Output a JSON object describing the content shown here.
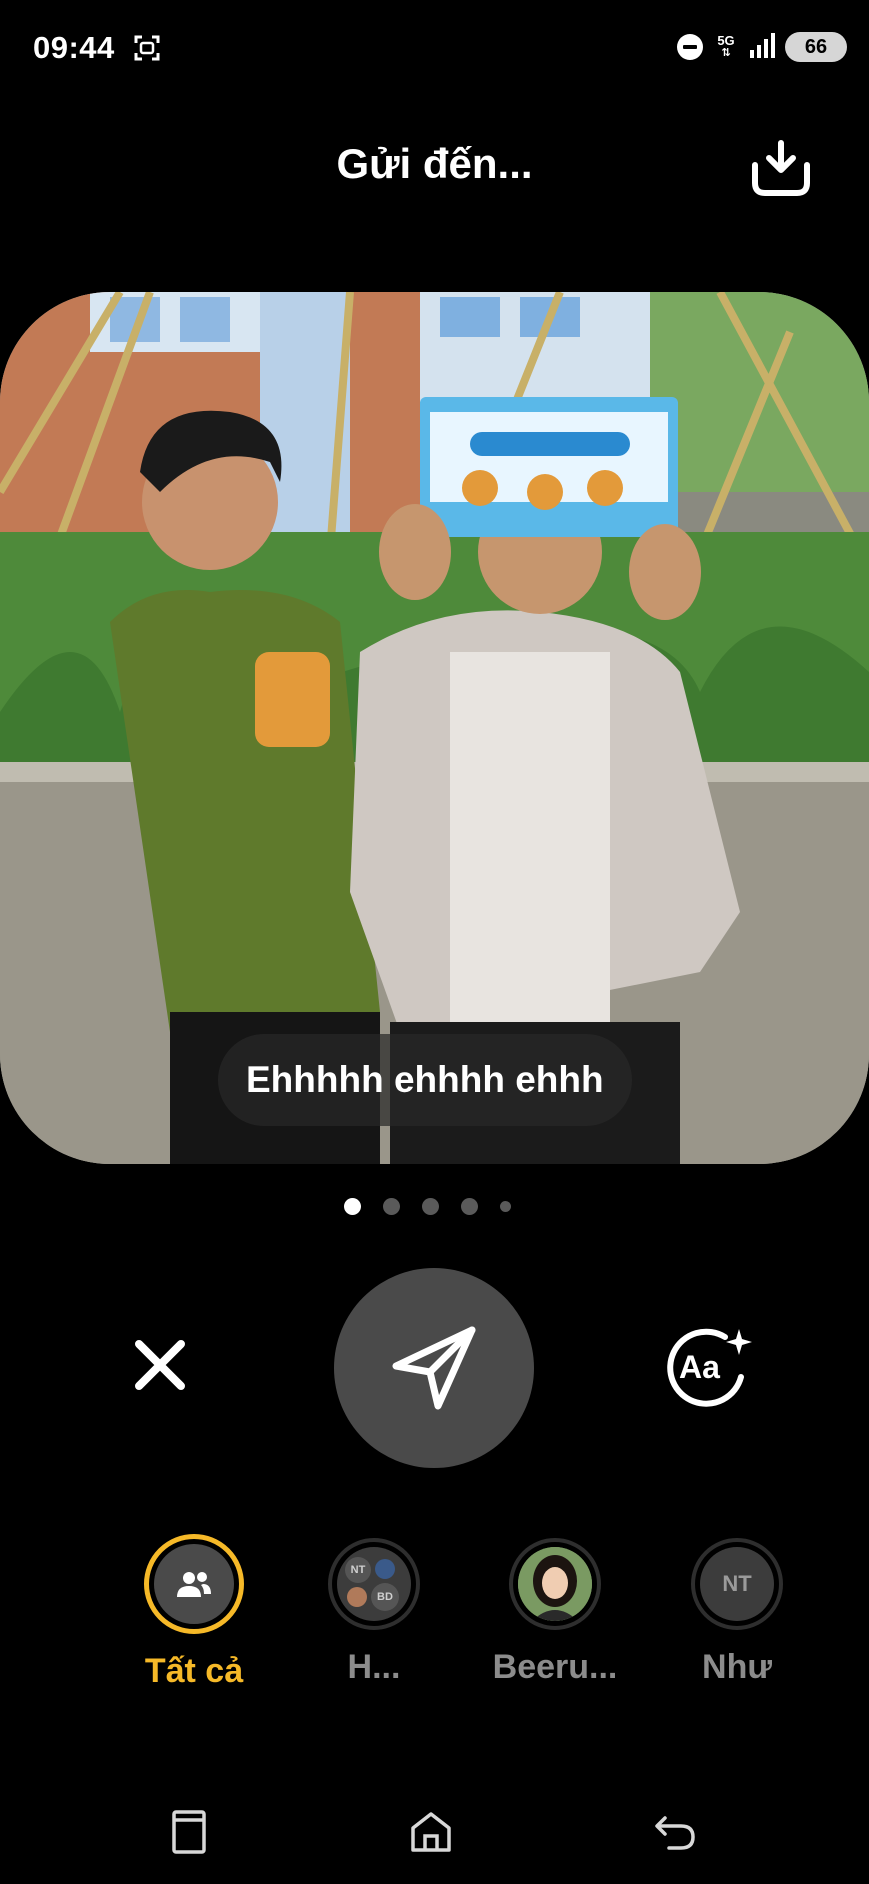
{
  "status_bar": {
    "time": "09:44",
    "network": "5G",
    "battery": "66",
    "icons": [
      "screenshot-icon",
      "do-not-disturb-icon",
      "signal-icon",
      "battery-icon"
    ]
  },
  "header": {
    "title": "Gửi đến...",
    "download_icon": "download-icon"
  },
  "photo": {
    "caption": "Ehhhhh ehhhh ehhh",
    "page_count": 5,
    "active_page": 1
  },
  "actions": {
    "close_icon": "close-icon",
    "send_icon": "send-icon",
    "text_style_label": "Aa",
    "text_style_icon": "text-style-sparkle-icon"
  },
  "recipients": [
    {
      "label": "Tất cả",
      "type": "group-icon",
      "selected": true
    },
    {
      "label": "H...",
      "type": "group-avatars",
      "mini_initials": [
        "NT",
        "BD"
      ],
      "selected": false
    },
    {
      "label": "Beeru...",
      "type": "photo",
      "selected": false
    },
    {
      "label": "Như",
      "type": "initials",
      "initials": "NT",
      "selected": false
    }
  ],
  "nav_bar": {
    "icons": [
      "recent-apps-icon",
      "home-icon",
      "back-icon"
    ]
  },
  "colors": {
    "background": "#000000",
    "accent": "#f6b928",
    "send_button": "#4a4a4a",
    "muted_text": "#8c8c8c"
  }
}
